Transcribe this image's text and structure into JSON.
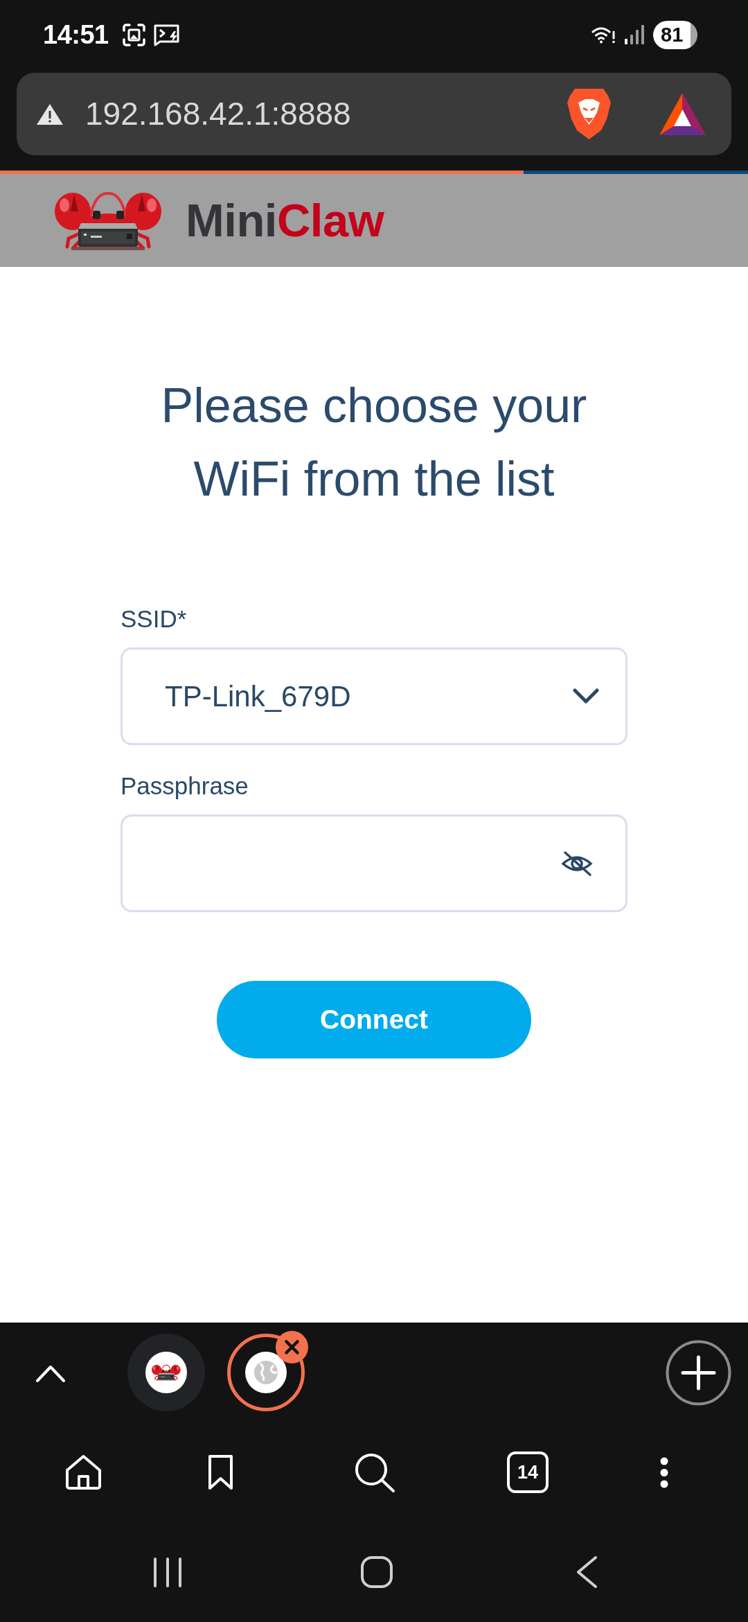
{
  "status_bar": {
    "time": "14:51",
    "battery": "81"
  },
  "address_bar": {
    "url": "192.168.42.1:8888"
  },
  "page_load": {
    "level": 0.7
  },
  "header": {
    "logo_text": [
      {
        "text": "Mini",
        "color": "#333538"
      },
      {
        "text": "Claw",
        "color": "#c4001a"
      }
    ]
  },
  "form": {
    "heading": "Please choose your WiFi from the list",
    "fields": [
      {
        "kind": "select",
        "label": "SSID*",
        "value": "TP-Link_679D"
      },
      {
        "kind": "password",
        "label": "Passphrase"
      }
    ],
    "submit": "Connect"
  },
  "tab_strip": {
    "tabs": [
      {
        "kind": "logo",
        "selected": false
      },
      {
        "kind": "globe",
        "selected": true
      }
    ]
  },
  "toolbar": {
    "tab_count": "14"
  }
}
